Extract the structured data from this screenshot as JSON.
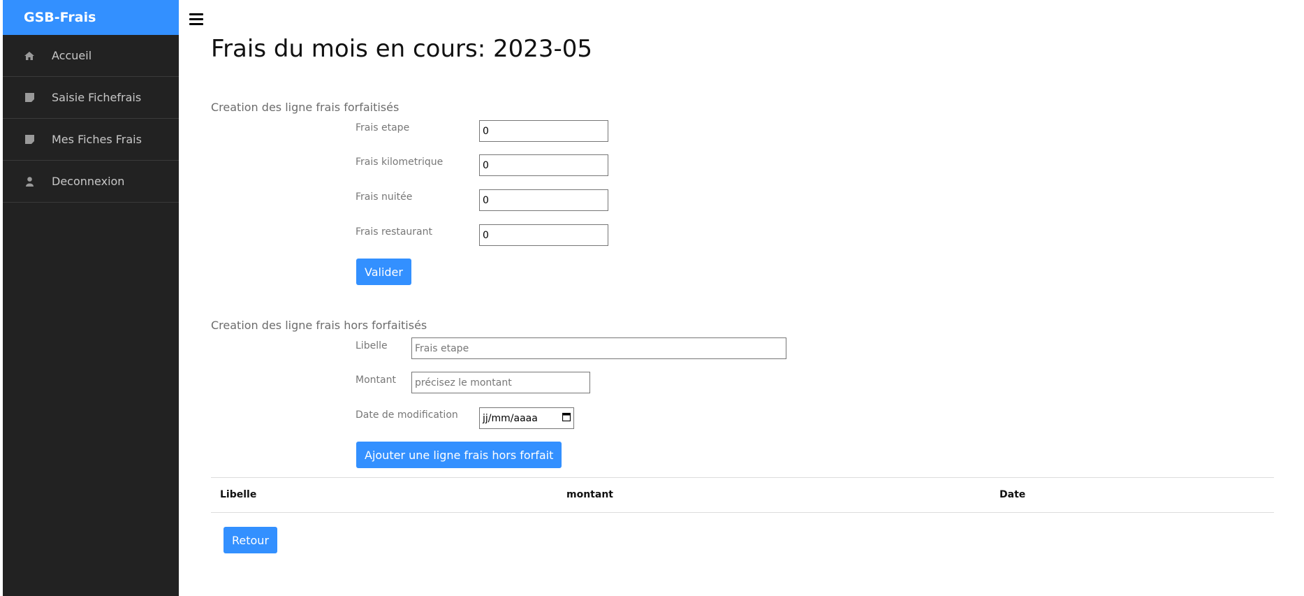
{
  "sidebar": {
    "brand": "GSB-Frais",
    "items": [
      {
        "label": "Accueil",
        "icon": "home-icon"
      },
      {
        "label": "Saisie Fichefrais",
        "icon": "note-icon"
      },
      {
        "label": "Mes Fiches Frais",
        "icon": "note-icon"
      },
      {
        "label": "Deconnexion",
        "icon": "user-icon"
      }
    ]
  },
  "main": {
    "title": "Frais du mois en cours: 2023-05",
    "forfait": {
      "heading": "Creation des ligne frais forfaitisés",
      "fields": [
        {
          "label": "Frais etape",
          "value": "0"
        },
        {
          "label": "Frais kilometrique",
          "value": "0"
        },
        {
          "label": "Frais nuitée",
          "value": "0"
        },
        {
          "label": "Frais restaurant",
          "value": "0"
        }
      ],
      "submit_label": "Valider"
    },
    "hors_forfait": {
      "heading": "Creation des ligne frais hors forfaitisés",
      "libelle_label": "Libelle",
      "libelle_placeholder": "Frais etape",
      "montant_label": "Montant",
      "montant_placeholder": "précisez le montant",
      "date_label": "Date de modification",
      "date_placeholder": "jj/mm/aaaa",
      "submit_label": "Ajouter une ligne frais hors forfait"
    },
    "table": {
      "columns": [
        "Libelle",
        "montant",
        "Date"
      ]
    },
    "back_label": "Retour"
  },
  "colors": {
    "accent": "#3390ff",
    "sidebar_bg": "#222222"
  }
}
